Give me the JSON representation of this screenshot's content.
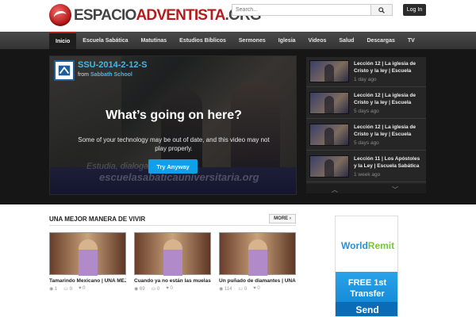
{
  "header": {
    "logo_part1": "ESPACIO",
    "logo_part2": "ADVENTISTA",
    "logo_part3": ".ORG",
    "search_placeholder": "Search...",
    "login_label": "Log In"
  },
  "nav": {
    "items": [
      "Inicio",
      "Escuela Sabática",
      "Matutinas",
      "Estudios Bíblicos",
      "Sermones",
      "Iglesia",
      "Videos",
      "Salud",
      "Descargas",
      "TV"
    ]
  },
  "player": {
    "title": "SSU-2014-2-12-S",
    "from_prefix": "from",
    "from_channel": "Sabbath School",
    "headline": "What’s going on here?",
    "message": "Some of your technology may be out of date, and this video may not play properly.",
    "cta_label": "Try Anyway",
    "scene_text1": "Estudia, dialoga...",
    "scene_text2": "escuelasabaticauniversitaria.org"
  },
  "playlist": {
    "items": [
      {
        "title": "Lección 12 | La iglesia de Cristo y la ley | Escuela",
        "time": "1 day ago"
      },
      {
        "title": "Lección 12 | La iglesia de Cristo y la ley | Escuela",
        "time": "5 days ago"
      },
      {
        "title": "Lección 12 | La iglesia de Cristo y la ley | Escuela",
        "time": "5 days ago"
      },
      {
        "title": "Lección 11 | Los Apóstoles y la Ley | Escuela Sabática",
        "time": "1 week ago"
      }
    ]
  },
  "section": {
    "title": "UNA MEJOR MANERA DE VIVIR",
    "more_label": "MORE ›",
    "cards": [
      {
        "title": "Tamarindo Mexicano | UNA MEJ...",
        "views": "1",
        "comments": "0",
        "likes": "0"
      },
      {
        "title": "Cuando ya no están las muelas ...",
        "views": "69",
        "comments": "0",
        "likes": "0"
      },
      {
        "title": "Un puñado de diamantes | UNA ...",
        "views": "114",
        "comments": "0",
        "likes": "0"
      }
    ]
  },
  "ad": {
    "brand_a": "World",
    "brand_b": "Remit",
    "line1": "FREE 1st",
    "line2": "Transfer",
    "cta": "Send"
  }
}
